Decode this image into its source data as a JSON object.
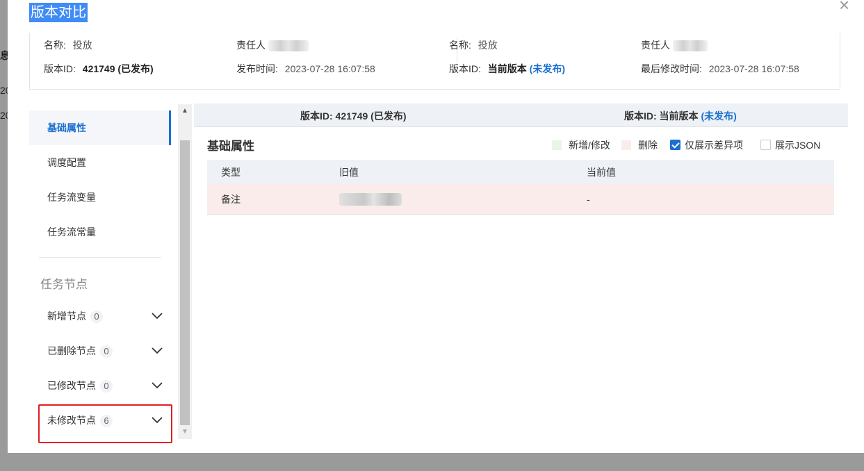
{
  "background_fragments": [
    "息",
    "20",
    "20"
  ],
  "modal": {
    "title": "版本对比",
    "close": "×"
  },
  "info": {
    "left": {
      "name_label": "名称:",
      "name_value": "投放",
      "owner_label": "责任人",
      "version_label": "版本ID:",
      "version_value": "421749 (已发布)",
      "time_label": "发布时间:",
      "time_value": "2023-07-28 16:07:58"
    },
    "right": {
      "name_label": "名称:",
      "name_value": "投放",
      "owner_label": "责任人",
      "version_label": "版本ID:",
      "version_value": "当前版本",
      "version_status": "(未发布)",
      "time_label": "最后修改时间:",
      "time_value": "2023-07-28 16:07:58"
    }
  },
  "sidebar": {
    "items": [
      {
        "label": "基础属性",
        "active": true
      },
      {
        "label": "调度配置",
        "active": false
      },
      {
        "label": "任务流变量",
        "active": false
      },
      {
        "label": "任务流常量",
        "active": false
      }
    ],
    "section_title": "任务节点",
    "nodes": [
      {
        "label": "新增节点",
        "count": "0"
      },
      {
        "label": "已删除节点",
        "count": "0"
      },
      {
        "label": "已修改节点",
        "count": "0"
      },
      {
        "label": "未修改节点",
        "count": "6"
      }
    ]
  },
  "compare_header": {
    "left": "版本ID: 421749 (已发布)",
    "right_prefix": "版本ID: 当前版本",
    "right_status": "(未发布)"
  },
  "section": {
    "title": "基础属性",
    "legend_added": "新增/修改",
    "legend_deleted": "删除",
    "only_diff_label": "仅展示差异项",
    "only_diff_checked": true,
    "show_json_label": "展示JSON",
    "show_json_checked": false
  },
  "table": {
    "headers": [
      "类型",
      "旧值",
      "当前值"
    ],
    "rows": [
      {
        "type": "备注",
        "old": "",
        "current": "-"
      }
    ]
  },
  "colors": {
    "accent": "#1a6fd1",
    "added_swatch": "#e8f6e8",
    "deleted_swatch": "#f9ecea",
    "highlight_border": "#e02020"
  }
}
